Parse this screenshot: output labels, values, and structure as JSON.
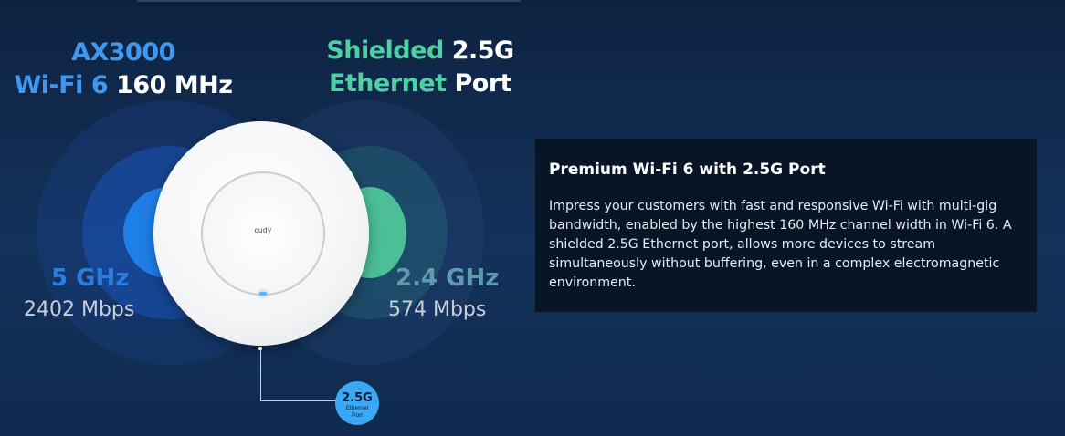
{
  "headline_left": {
    "line1": "AX3000",
    "line2_blue": "Wi-Fi 6",
    "line2_white": "160 MHz"
  },
  "headline_right": {
    "line1_teal": "Shielded",
    "line1_white": "2.5G",
    "line2_teal": "Ethernet",
    "line2_white": "Port"
  },
  "bands": [
    {
      "band": "5 GHz",
      "speed": "2402 Mbps",
      "color": "#2c7de0"
    },
    {
      "band": "2.4 GHz",
      "speed": "574 Mbps",
      "color": "#5f9ab0"
    }
  ],
  "device": {
    "logo": "cudy"
  },
  "port_badge": {
    "big": "2.5G",
    "line1": "Ethernet",
    "line2": "Port"
  },
  "card": {
    "title": "Premium Wi-Fi 6 with 2.5G Port",
    "body": "Impress your customers with fast and responsive Wi-Fi with multi-gig bandwidth, enabled by the highest 160 MHz channel width in Wi-Fi 6. A shielded 2.5G Ethernet port, allows more devices to stream simultaneously without buffering, even in a complex electromagnetic environment."
  },
  "colors": {
    "accent_blue": "#3f98f0",
    "accent_teal": "#4fd0a4",
    "card_bg": "#071527"
  }
}
